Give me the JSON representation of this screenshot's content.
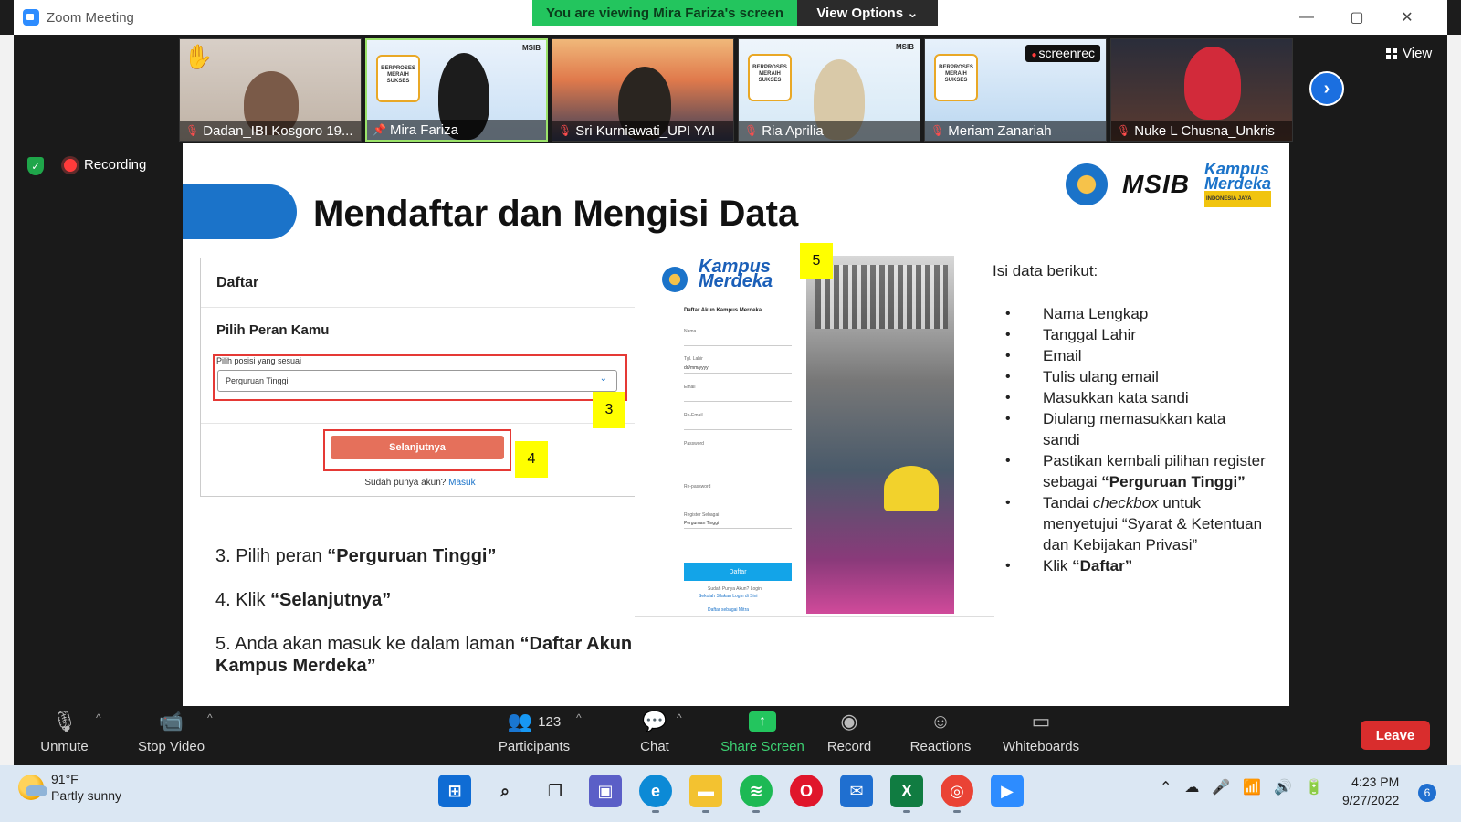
{
  "window": {
    "title": "Zoom Meeting",
    "minimize": "—",
    "maximize": "▢",
    "close": "✕"
  },
  "share_banner": {
    "text": "You are viewing Mira Fariza's screen",
    "view_options": "View Options",
    "view_options_caret": "⌄"
  },
  "participants_strip": [
    {
      "name": "Dadan_IBI Kosgoro 19...",
      "muted": true,
      "hand_raised": true
    },
    {
      "name": "Mira Fariza",
      "muted": false,
      "pinned": true,
      "active": true
    },
    {
      "name": "Sri Kurniawati_UPI YAI",
      "muted": true
    },
    {
      "name": "Ria Aprilia",
      "muted": true
    },
    {
      "name": "Meriam Zanariah",
      "muted": true,
      "overlay": "screenrec"
    },
    {
      "name": "Nuke L Chusna_Unkris",
      "muted": true
    }
  ],
  "next_page_icon": "›",
  "view_button": "View",
  "recording_label": "Recording",
  "slide": {
    "title": "Mendaftar dan Mengisi Data",
    "logo_msib": "MSIB",
    "logo_km_line1": "Kampus",
    "logo_km_line2": "Merdeka",
    "logo_km_tag": "INDONESIA JAYA",
    "form": {
      "heading": "Daftar",
      "subheading": "Pilih Peran Kamu",
      "select_label": "Pilih posisi yang sesuai",
      "select_value": "Perguruan Tinggi",
      "next_button": "Selanjutnya",
      "already_text": "Sudah punya akun?",
      "login_link": "Masuk"
    },
    "badges": [
      "3",
      "4",
      "5"
    ],
    "steps": {
      "s3_prefix": "3. Pilih peran ",
      "s3_bold": "“Perguruan Tinggi”",
      "s4_prefix": "4. Klik ",
      "s4_bold": "“Selanjutnya”",
      "s5_prefix": "5. Anda akan masuk ke dalam laman ",
      "s5_bold": "“Daftar Akun Kampus Merdeka”"
    },
    "reg_form": {
      "title": "Daftar Akun Kampus Merdeka",
      "labels": [
        "Nama",
        "Tgl. Lahir",
        "Email",
        "Re-Email",
        "Password",
        "Re-password",
        "Register Sebagai"
      ],
      "date_placeholder": "dd/mm/yyyy",
      "register_value": "Perguruan Tinggi",
      "submit": "Daftar",
      "already": "Sudah Punya Akun? Login",
      "school_link": "Sekolah Silakan Login di Sini",
      "mitra_link": "Daftar sebagai Mitra"
    },
    "isi": {
      "heading": "Isi data berikut:",
      "items": {
        "i1": "Nama Lengkap",
        "i2": "Tanggal Lahir",
        "i3": "Email",
        "i4": "Tulis ulang email",
        "i5": "Masukkan kata sandi",
        "i6": "Diulang memasukkan kata sandi",
        "i7_prefix": "Pastikan kembali pilihan register sebagai ",
        "i7_bold": "“Perguruan Tinggi”",
        "i8_a": "Tandai ",
        "i8_italic": "checkbox",
        "i8_b": " untuk menyetujui “Syarat & Ketentuan dan Kebijakan Privasi”",
        "i9_prefix": "Klik ",
        "i9_bold": "“Daftar”"
      }
    }
  },
  "controls": {
    "unmute": "Unmute",
    "stop_video": "Stop Video",
    "participants": "Participants",
    "participants_count": "123",
    "chat": "Chat",
    "share_screen": "Share Screen",
    "record": "Record",
    "reactions": "Reactions",
    "whiteboards": "Whiteboards",
    "leave": "Leave"
  },
  "taskbar": {
    "weather_temp": "91°F",
    "weather_desc": "Partly sunny",
    "time": "4:23 PM",
    "date": "9/27/2022",
    "notifications": "6"
  },
  "colors": {
    "zoom_blue": "#2d8cff",
    "banner_green": "#23c55e",
    "leave_red": "#d92d2d",
    "slide_blue": "#1b73c9",
    "highlight_yellow": "#ffff00",
    "annotation_red": "#e53935"
  }
}
